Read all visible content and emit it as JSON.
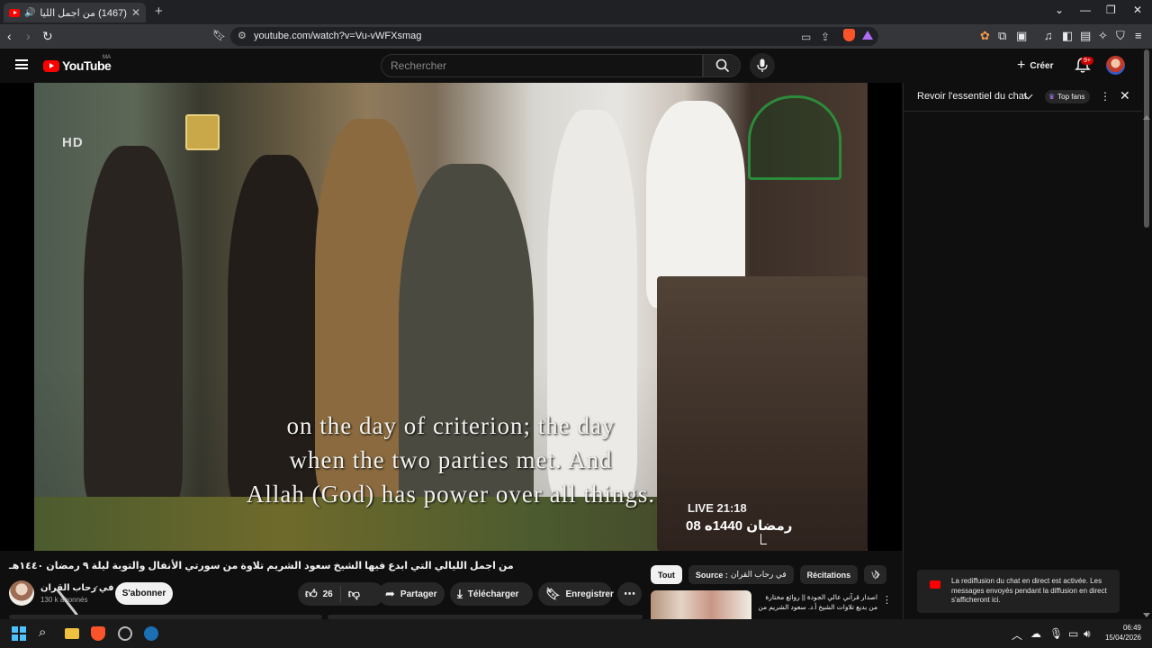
{
  "browser": {
    "tab_title": "(1467) من اجمل الليالي التي ا...",
    "new_tab_icon": "plus-icon",
    "url": "youtube.com/watch?v=Vu-vWFXsmag"
  },
  "youtube": {
    "logo_text": "YouTube",
    "country_code": "MA",
    "search_placeholder": "Rechercher",
    "create_label": "Créer",
    "notification_count": "9+"
  },
  "video": {
    "subtitle_lines": [
      "on the day of criterion; the day",
      "when the two parties met. And",
      "Allah (God) has power over all things."
    ],
    "live_time": "LIVE 21:18",
    "date_overlay": "08 رمضان 1440ه",
    "hd_logo": "HD",
    "title": "من اجمل الليالي التي ابدع فيها الشيخ سعود الشريم تلاوة من سورتي الأنفال والتوبة ليلة ٩ رمضان ١٤٤٠هـ"
  },
  "channel": {
    "name": "في رحاب القران",
    "subscribers": "130 k abonnés",
    "subscribe_label": "S'abonner"
  },
  "actions": {
    "like_count": "26",
    "share_label": "Partager",
    "download_label": "Télécharger",
    "save_label": "Enregistrer"
  },
  "chips": {
    "all": "Tout",
    "source_prefix": "Source : ",
    "source_name": "في رحاب القران",
    "recitations": "Récitations",
    "partial": "Vi"
  },
  "recommended": {
    "title": "اصدار قرآني عالي الجودة || روائع مختارة من بديع تلاوات الشيخ أ.د. سعود الشريم من"
  },
  "chat": {
    "title": "Revoir l'essentiel du chat",
    "top_fans": "Top fans",
    "toast": "La rediffusion du chat en direct est activée. Les messages envoyés pendant la diffusion en direct s'afficheront ici."
  },
  "taskbar": {
    "time": "06:49",
    "date": "15/04/2026"
  },
  "colors": {
    "accent": "#ff0000",
    "background": "#0f0f0f",
    "surface": "#272727"
  }
}
